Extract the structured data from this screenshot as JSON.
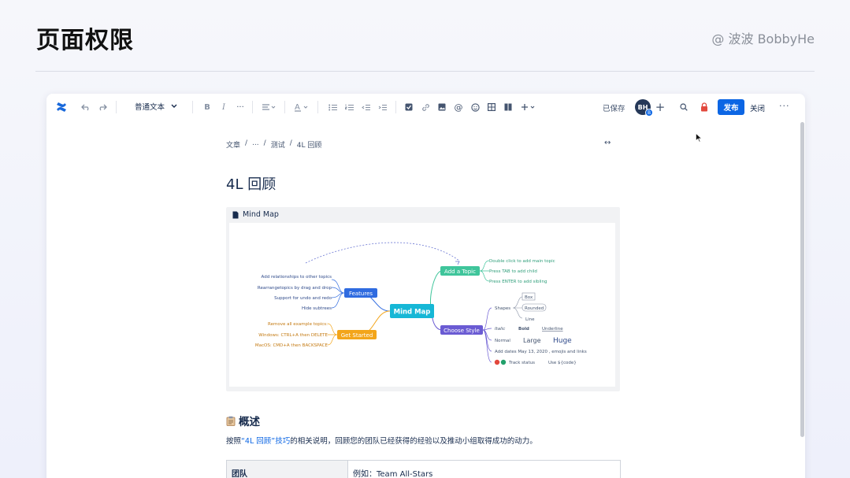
{
  "slide": {
    "title": "页面权限",
    "author": "@ 波波 BobbyHe"
  },
  "toolbar": {
    "text_style": "普通文本",
    "saved": "已保存",
    "avatar_initials": "BH",
    "avatar_badge": "B",
    "publish": "发布",
    "close": "关闭",
    "more": "···"
  },
  "breadcrumb": {
    "items": [
      "文章",
      "/",
      "...",
      "/",
      "测试",
      "/",
      "4L 回顾"
    ]
  },
  "page": {
    "title": "4L 回顾",
    "width_toggle": "↔"
  },
  "macro": {
    "title": "Mind Map",
    "center": "Mind Map",
    "branches": {
      "features": "Features",
      "get_started": "Get Started",
      "add_topic": "Add a Topic",
      "choose_style": "Choose Style"
    },
    "features_items": [
      "Add relationships to other topics",
      "Rearrangetopics by drag and drop",
      "Support for undo and redo",
      "Hide subtrees"
    ],
    "get_started_items": [
      "Remove all example topics:",
      "Windows: CTRL+A then DELETE",
      "MacOS: CMD+A then BACKSPACE"
    ],
    "add_topic_items": [
      "Double click to add main topic",
      "Press TAB to add child",
      "Press ENTER to add sibling"
    ],
    "style_items": {
      "shapes": "Shapes",
      "box": "Box",
      "rounded": "Rounded",
      "line": "Line",
      "italic": "Italic",
      "bold": "Bold",
      "underline": "Underline",
      "normal": "Normal",
      "large": "Large",
      "huge": "Huge",
      "dates": "Add dates May 13, 2020 , emojis and links",
      "track": "Track status",
      "code": "Use ${code}"
    }
  },
  "overview": {
    "heading": "概述",
    "text_before": "按照",
    "link": "“4L 回顾”技巧",
    "text_after": "的相关说明，回顾您的团队已经获得的经验以及推动小组取得成功的动力。"
  },
  "table": {
    "header": "团队",
    "value": "例如：Team All-Stars"
  }
}
